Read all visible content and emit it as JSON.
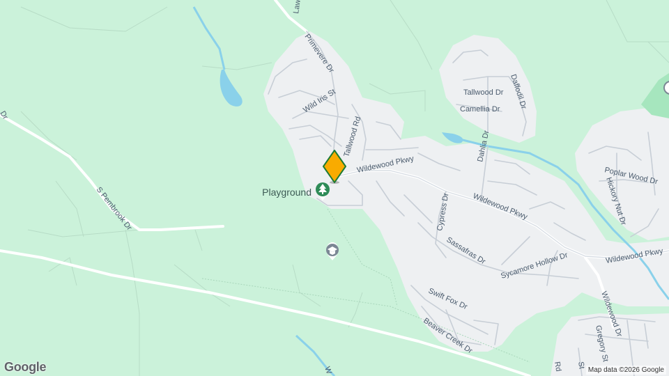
{
  "map": {
    "base_color": "#cbf2da",
    "residential_color": "#eef0f2",
    "road_color": "#ffffff",
    "water_color": "#8ad1ea",
    "park_color": "#a6e6be",
    "streets": {
      "lawn": "Lawn",
      "primevere": "Primevere Dr",
      "wild_iris": "Wild Iris St",
      "tallwood_rd": "Tallwood Rd",
      "tallwood_dr": "Tallwood Dr",
      "daffodil": "Daffodil Dr",
      "camellia": "Camellia Dr",
      "dahlia": "Dahlia Dr",
      "wildewood_pkwy_1": "Wildewood Pkwy",
      "wildewood_pkwy_2": "Wildewood Pkwy",
      "wildewood_pkwy_3": "Wildewood Pkwy",
      "cypress": "Cypress Dr",
      "sassafras": "Sassafras Dr",
      "sycamore": "Sycamore Hollow Dr",
      "swift_fox": "Swift Fox Dr",
      "beaver_creek": "Beaver Creek Dr",
      "poplar_wood": "Poplar Wood Dr",
      "hickory_nut": "Hickory Nut Dr",
      "wildewood_dr": "Wildewood Dr",
      "gregory": "Gregory St",
      "s_pembrook": "S Pembrook Dr",
      "edge_dr": "Dr",
      "bottom_rd": "Rd",
      "bottom_st": "St",
      "bottom_w": "W"
    },
    "poi": {
      "playground_label": "Playground",
      "playground_icon": "tree-icon",
      "school_icon": "graduation-cap-icon"
    },
    "marker": {
      "icon": "location-marker-icon",
      "fill": "#f9ab00",
      "stroke": "#1e7b34"
    },
    "attribution": "Map data ©2026 Google",
    "logo": "Google"
  }
}
